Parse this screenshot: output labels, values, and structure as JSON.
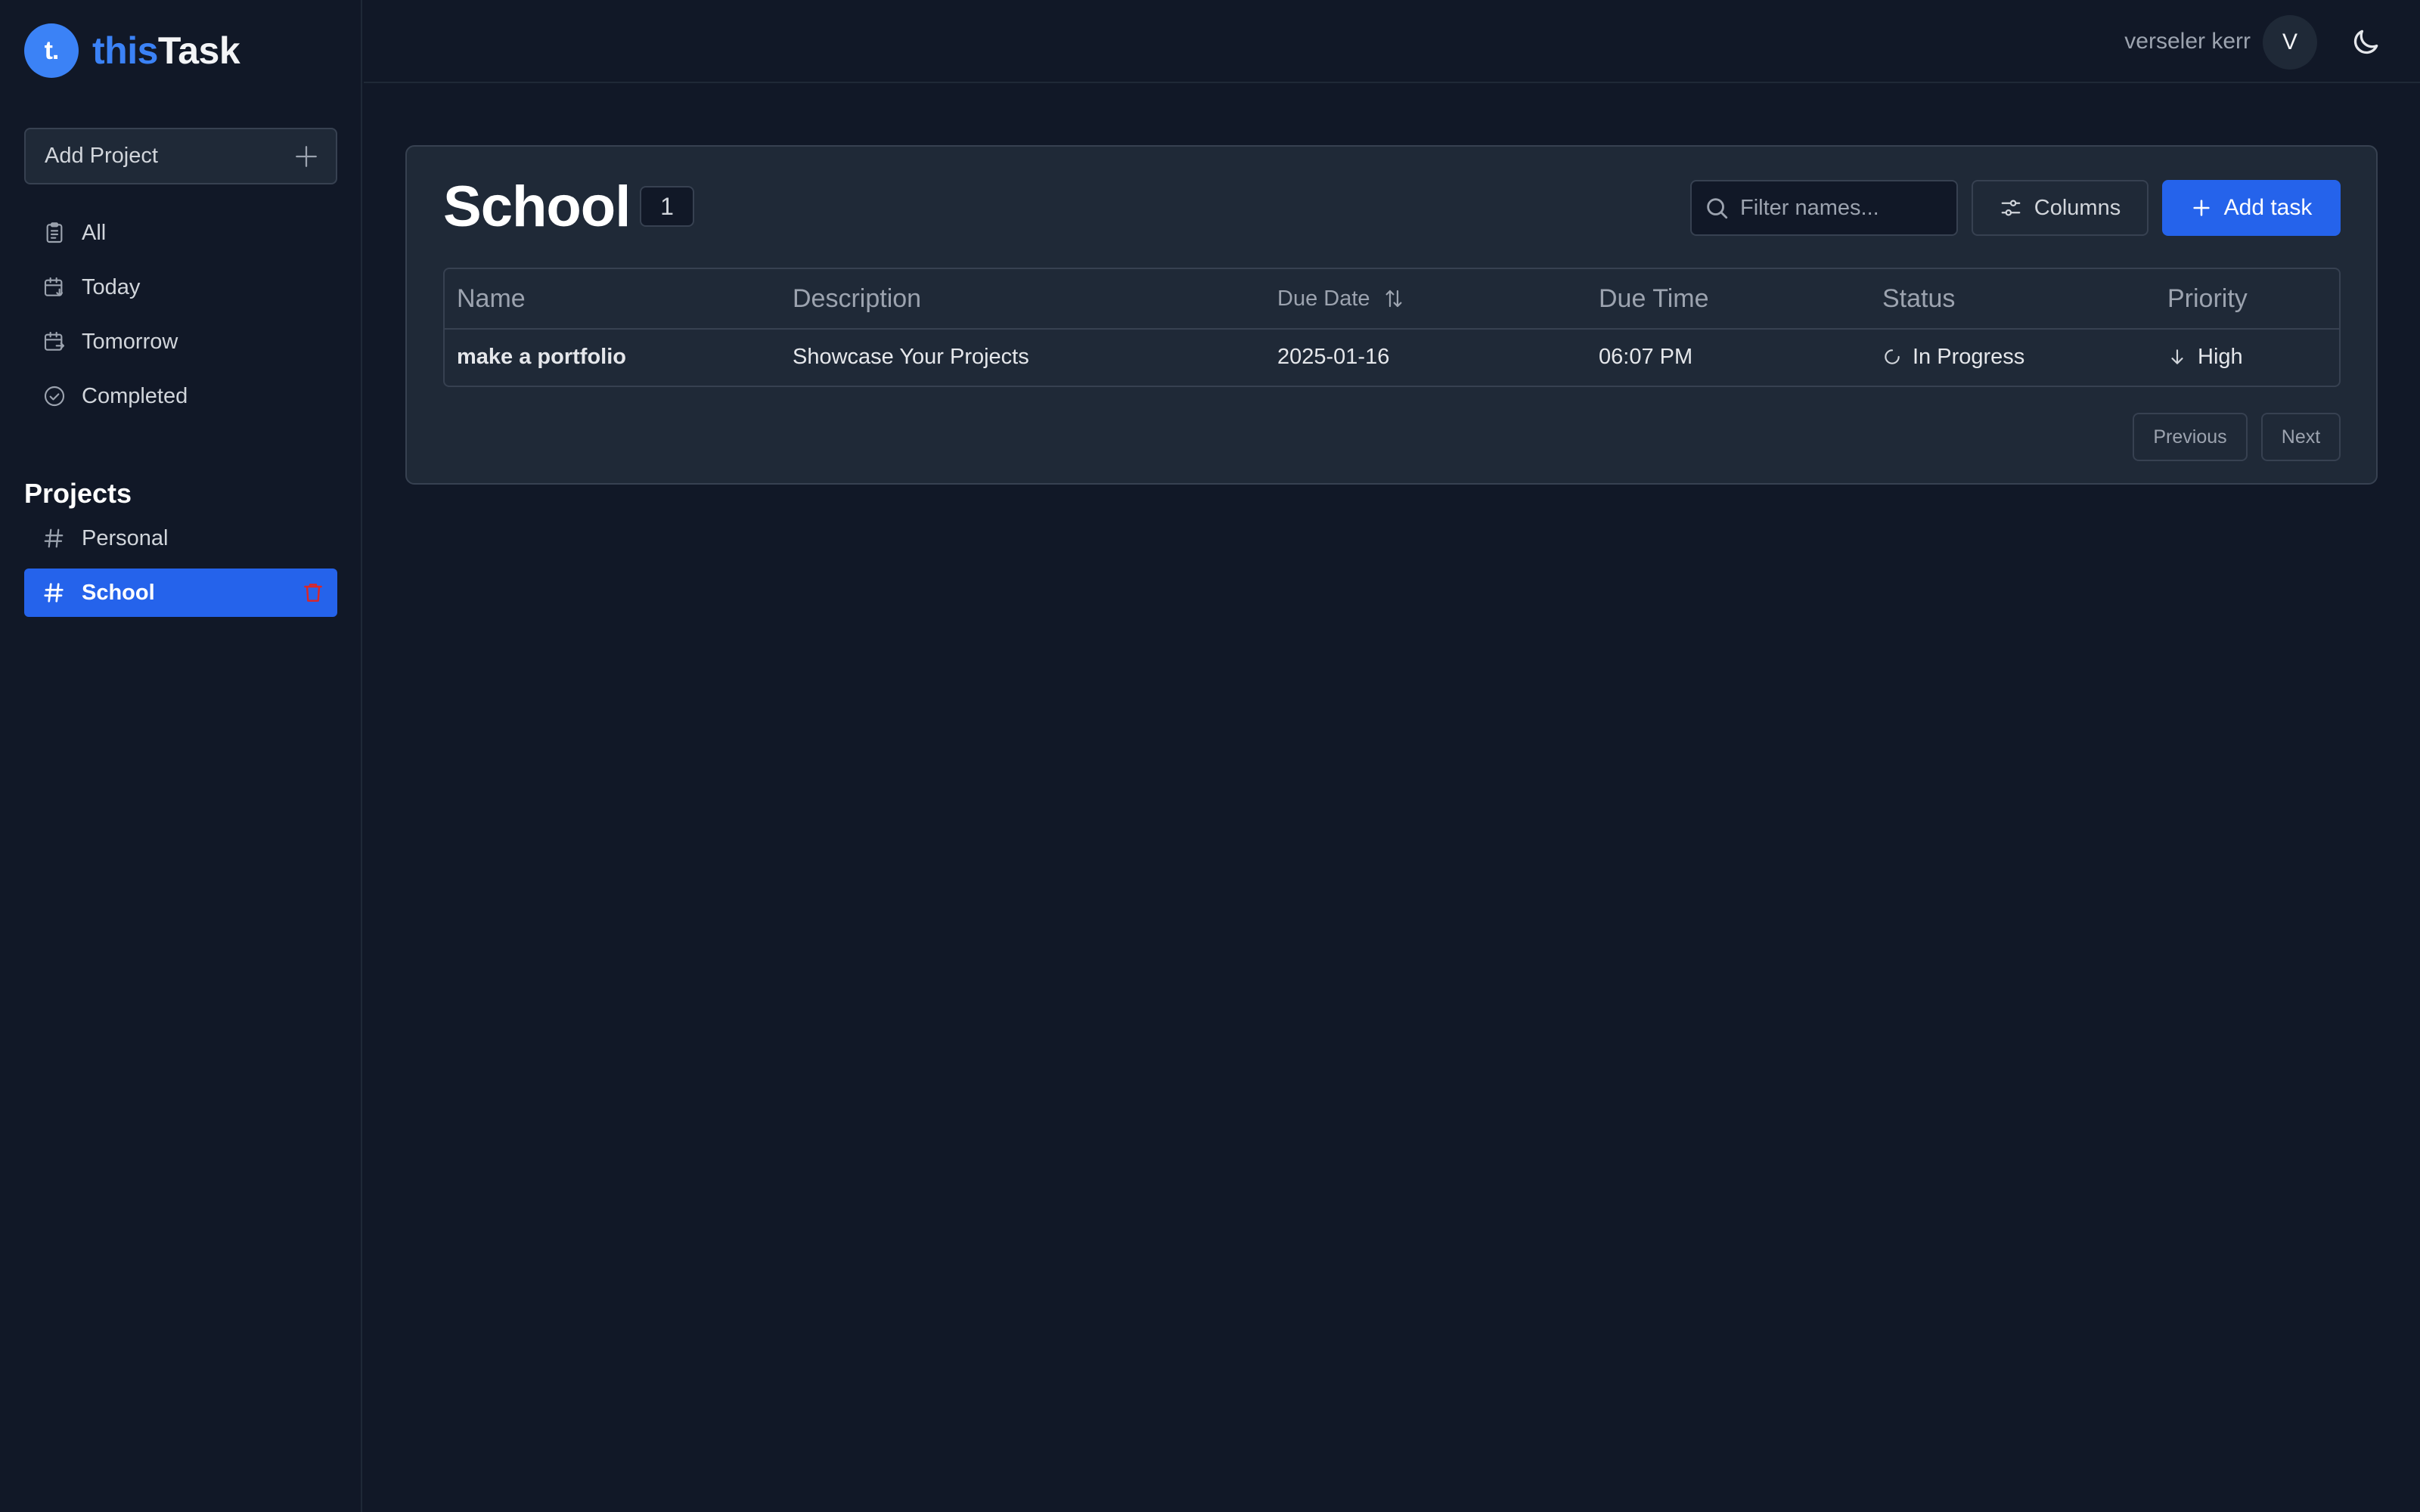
{
  "app": {
    "logo_mark": "t.",
    "logo_part1": "this",
    "logo_part2": "Task"
  },
  "sidebar": {
    "add_project_label": "Add Project",
    "nav": [
      {
        "label": "All",
        "icon": "clipboard-list-icon"
      },
      {
        "label": "Today",
        "icon": "calendar-today-icon"
      },
      {
        "label": "Tomorrow",
        "icon": "calendar-tomorrow-icon"
      },
      {
        "label": "Completed",
        "icon": "check-circle-icon"
      }
    ],
    "projects_title": "Projects",
    "projects": [
      {
        "label": "Personal",
        "active": false
      },
      {
        "label": "School",
        "active": true
      }
    ]
  },
  "topbar": {
    "user_name": "verseler kerr",
    "avatar_initial": "V",
    "theme_icon": "moon-icon"
  },
  "main": {
    "title": "School",
    "count": "1",
    "search_placeholder": "Filter names...",
    "columns_label": "Columns",
    "add_task_label": "Add task",
    "table": {
      "headers": [
        "Name",
        "Description",
        "Due Date",
        "Due Time",
        "Status",
        "Priority"
      ],
      "rows": [
        {
          "name": "make a portfolio",
          "description": "Showcase Your Projects",
          "due_date": "2025-01-16",
          "due_time": "06:07 PM",
          "status": "In Progress",
          "priority": "High"
        }
      ]
    },
    "pagination": {
      "previous": "Previous",
      "next": "Next"
    }
  },
  "colors": {
    "accent": "#2563eb",
    "logo": "#3b82f6",
    "background": "#111827",
    "card": "#1f2937",
    "danger": "#dc2626"
  }
}
